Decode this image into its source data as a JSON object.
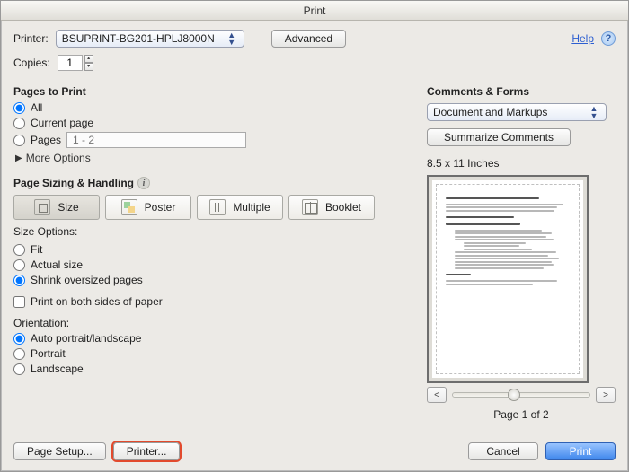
{
  "window": {
    "title": "Print"
  },
  "header": {
    "printer_label": "Printer:",
    "printer_value": "BSUPRINT-BG201-HPLJ8000N",
    "advanced": "Advanced",
    "help": "Help",
    "copies_label": "Copies:",
    "copies_value": "1"
  },
  "pages_to_print": {
    "title": "Pages to Print",
    "all": "All",
    "current": "Current page",
    "pages": "Pages",
    "pages_placeholder": "1 - 2",
    "more_options": "More Options"
  },
  "sizing": {
    "title": "Page Sizing & Handling",
    "seg": {
      "size": "Size",
      "poster": "Poster",
      "multiple": "Multiple",
      "booklet": "Booklet"
    },
    "size_options_label": "Size Options:",
    "fit": "Fit",
    "actual": "Actual size",
    "shrink": "Shrink oversized pages",
    "both_sides": "Print on both sides of paper",
    "orientation_label": "Orientation:",
    "auto": "Auto portrait/landscape",
    "portrait": "Portrait",
    "landscape": "Landscape"
  },
  "comments": {
    "title": "Comments & Forms",
    "dropdown_value": "Document and Markups",
    "summarize": "Summarize Comments",
    "dimensions": "8.5 x 11 Inches",
    "page_indicator": "Page 1 of 2"
  },
  "footer": {
    "page_setup": "Page Setup...",
    "printer": "Printer...",
    "cancel": "Cancel",
    "print": "Print"
  }
}
